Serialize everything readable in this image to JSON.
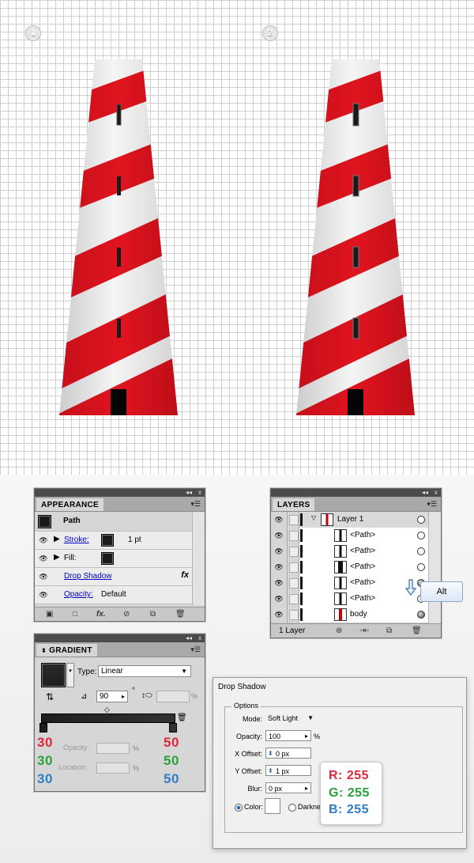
{
  "steps": [
    "1",
    "2"
  ],
  "appearance": {
    "tab": "APPEARANCE",
    "header": "Path",
    "stroke_label": "Stroke:",
    "stroke_value": "1 pt",
    "fill_label": "Fill:",
    "drop_shadow": "Drop Shadow",
    "fx": "fx",
    "opacity_label": "Opacity:",
    "opacity_value": "Default"
  },
  "layers": {
    "tab": "LAYERS",
    "rows": [
      "Layer 1",
      "<Path>",
      "<Path>",
      "<Path>",
      "<Path>",
      "<Path>",
      "body"
    ],
    "footer": "1 Layer",
    "alt_button": "Alt"
  },
  "gradient": {
    "tab": "GRADIENT",
    "type_label": "Type:",
    "type_value": "Linear",
    "angle_value": "90",
    "degree": "°",
    "percent": "%",
    "opacity_label": "Opacity:",
    "location_label": "Location:",
    "left_stop": {
      "r": "30",
      "g": "30",
      "b": "30"
    },
    "right_stop": {
      "r": "50",
      "g": "50",
      "b": "50"
    }
  },
  "drop_shadow": {
    "title": "Drop Shadow",
    "options_label": "Options",
    "mode_label": "Mode:",
    "mode_value": "Soft Light",
    "opacity_label": "Opacity:",
    "opacity_value": "100",
    "percent": "%",
    "x_label": "X Offset:",
    "x_value": "0 px",
    "y_label": "Y Offset:",
    "y_value": "1 px",
    "blur_label": "Blur:",
    "blur_value": "0 px",
    "color_label": "Color:",
    "darkness_label": "Darknes",
    "rgb": {
      "r": "R: 255",
      "g": "G: 255",
      "b": "B: 255"
    }
  },
  "colors": {
    "stripe_red": "#d6121e",
    "tower_white": "#e8e8e8",
    "red_text": "#e0283a",
    "green_text": "#27a33a",
    "blue_text": "#2f7dc6"
  }
}
